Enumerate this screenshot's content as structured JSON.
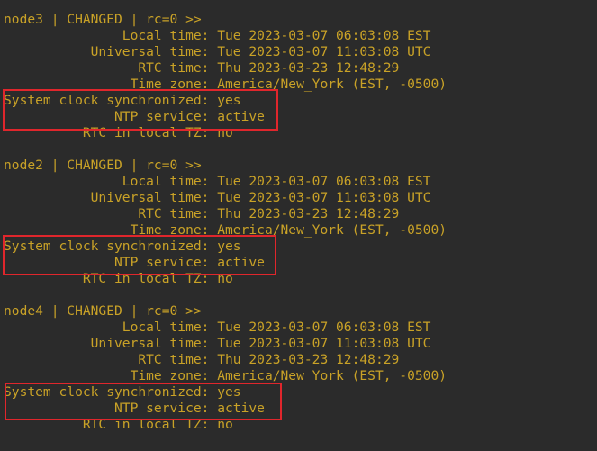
{
  "terminal": {
    "text_color": "#c9a227",
    "background": "#2b2b2b",
    "highlight_color": "#e0262c",
    "blocks": [
      {
        "header": "node3 | CHANGED | rc=0 >>",
        "local_time": "               Local time: Tue 2023-03-07 06:03:08 EST",
        "universal_time": "           Universal time: Tue 2023-03-07 11:03:08 UTC",
        "rtc_time": "                 RTC time: Thu 2023-03-23 12:48:29",
        "time_zone": "                Time zone: America/New_York (EST, -0500)",
        "clock_sync": "System clock synchronized: yes",
        "ntp_service": "              NTP service: active",
        "rtc_local_tz": "          RTC in local TZ: no"
      },
      {
        "header": "node2 | CHANGED | rc=0 >>",
        "local_time": "               Local time: Tue 2023-03-07 06:03:08 EST",
        "universal_time": "           Universal time: Tue 2023-03-07 11:03:08 UTC",
        "rtc_time": "                 RTC time: Thu 2023-03-23 12:48:29",
        "time_zone": "                Time zone: America/New_York (EST, -0500)",
        "clock_sync": "System clock synchronized: yes",
        "ntp_service": "              NTP service: active",
        "rtc_local_tz": "          RTC in local TZ: no"
      },
      {
        "header": "node4 | CHANGED | rc=0 >>",
        "local_time": "               Local time: Tue 2023-03-07 06:03:08 EST",
        "universal_time": "           Universal time: Tue 2023-03-07 11:03:08 UTC",
        "rtc_time": "                 RTC time: Thu 2023-03-23 12:48:29",
        "time_zone": "                Time zone: America/New_York (EST, -0500)",
        "clock_sync": "System clock synchronized: yes",
        "ntp_service": "              NTP service: active",
        "rtc_local_tz": "          RTC in local TZ: no"
      }
    ]
  }
}
